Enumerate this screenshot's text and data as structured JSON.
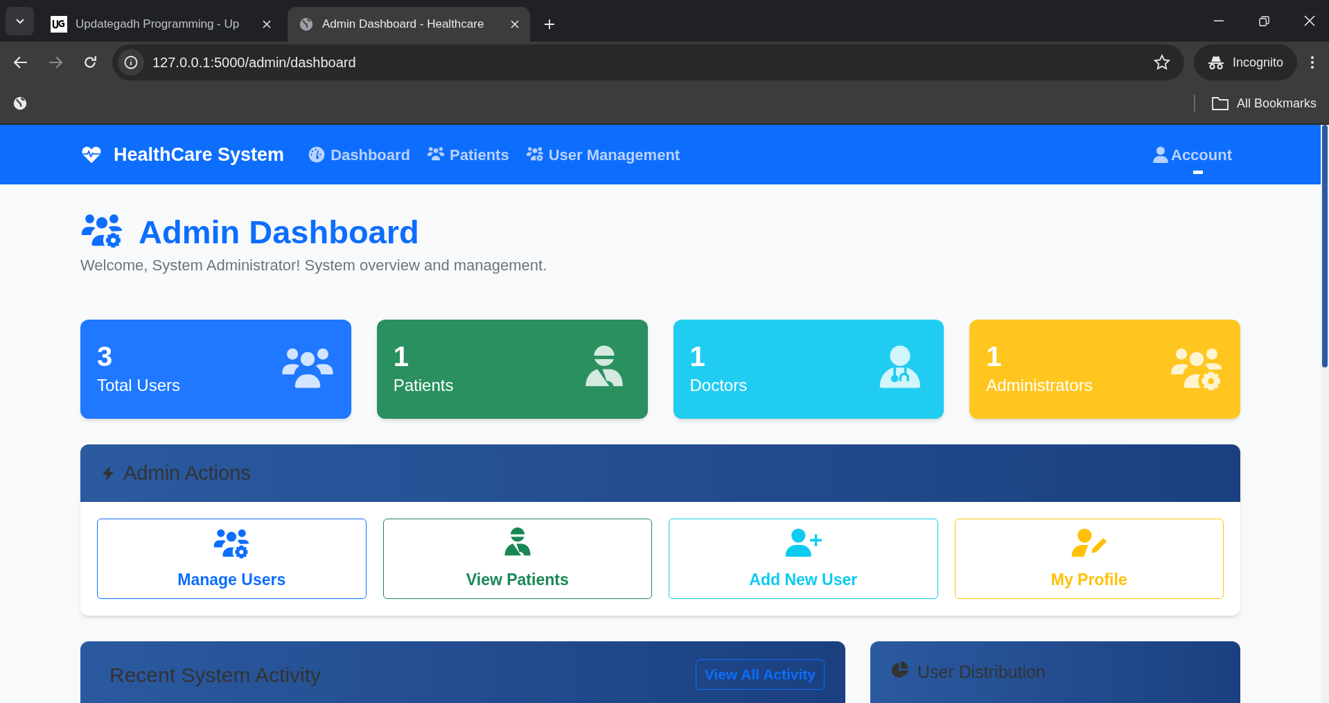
{
  "browser": {
    "tabs": [
      {
        "title": "Updategadh Programming - Up",
        "selected": false
      },
      {
        "title": "Admin Dashboard - Healthcare",
        "selected": true
      }
    ],
    "address": "127.0.0.1:5000/admin/dashboard",
    "profile": "Incognito",
    "bookmarks": "All Bookmarks"
  },
  "navbar": {
    "brand": "HealthCare System",
    "links": [
      {
        "label": "Dashboard"
      },
      {
        "label": "Patients"
      },
      {
        "label": "User Management"
      }
    ],
    "account": "Account"
  },
  "header": {
    "title": "Admin Dashboard",
    "subtitle": "Welcome, System Administrator! System overview and management."
  },
  "stats": [
    {
      "value": "3",
      "label": "Total Users",
      "color": "#1f78ff"
    },
    {
      "value": "1",
      "label": "Patients",
      "color": "#2a9060"
    },
    {
      "value": "1",
      "label": "Doctors",
      "color": "#20cdf0"
    },
    {
      "value": "1",
      "label": "Administrators",
      "color": "#ffc61f"
    }
  ],
  "admin_actions": {
    "title": "Admin Actions",
    "buttons": [
      {
        "label": "Manage Users",
        "color": "#0d6efd"
      },
      {
        "label": "View Patients",
        "color": "#198754"
      },
      {
        "label": "Add New User",
        "color": "#0dcaf0"
      },
      {
        "label": "My Profile",
        "color": "#ffc107"
      }
    ]
  },
  "recent_activity": {
    "title": "Recent System Activity",
    "button": "View All Activity"
  },
  "user_distribution": {
    "title": "User Distribution"
  }
}
